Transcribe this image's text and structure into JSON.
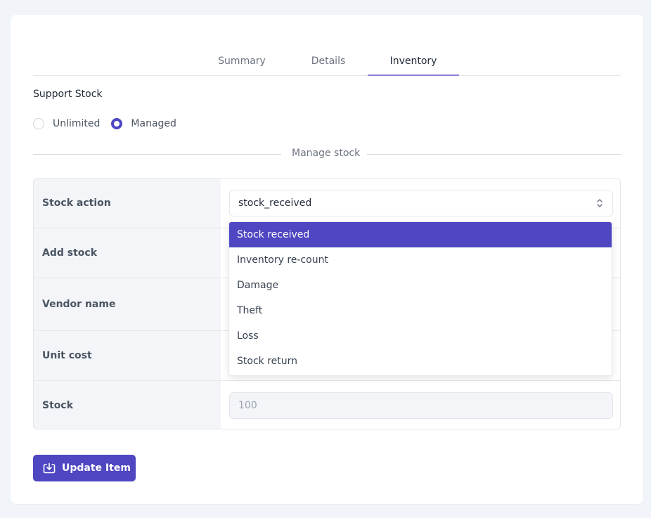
{
  "tabs": [
    {
      "label": "Summary",
      "active": false
    },
    {
      "label": "Details",
      "active": false
    },
    {
      "label": "Inventory",
      "active": true
    }
  ],
  "support_stock": {
    "label": "Support Stock",
    "options": [
      {
        "label": "Unlimited",
        "checked": false
      },
      {
        "label": "Managed",
        "checked": true
      }
    ]
  },
  "manage_stock": {
    "label": "Manage stock"
  },
  "form": {
    "rows": [
      {
        "label": "Stock action"
      },
      {
        "label": "Add stock"
      },
      {
        "label": "Vendor name"
      },
      {
        "label": "Unit cost"
      },
      {
        "label": "Stock"
      }
    ],
    "stock_action_value": "stock_received",
    "stock_value": "100"
  },
  "dropdown": {
    "options": [
      {
        "label": "Stock received",
        "selected": true
      },
      {
        "label": "Inventory re-count",
        "selected": false
      },
      {
        "label": "Damage",
        "selected": false
      },
      {
        "label": "Theft",
        "selected": false
      },
      {
        "label": "Loss",
        "selected": false
      },
      {
        "label": "Stock return",
        "selected": false
      }
    ]
  },
  "actions": {
    "update_label": "Update Item"
  },
  "colors": {
    "accent": "#4f46c2",
    "tab_underline": "#8b80d6",
    "page_bg": "#f1f4f8",
    "label_bg": "#f3f5f8"
  },
  "icons": {
    "select_chevron": "chevron-up-down-icon",
    "update_button": "download-tray-icon"
  }
}
